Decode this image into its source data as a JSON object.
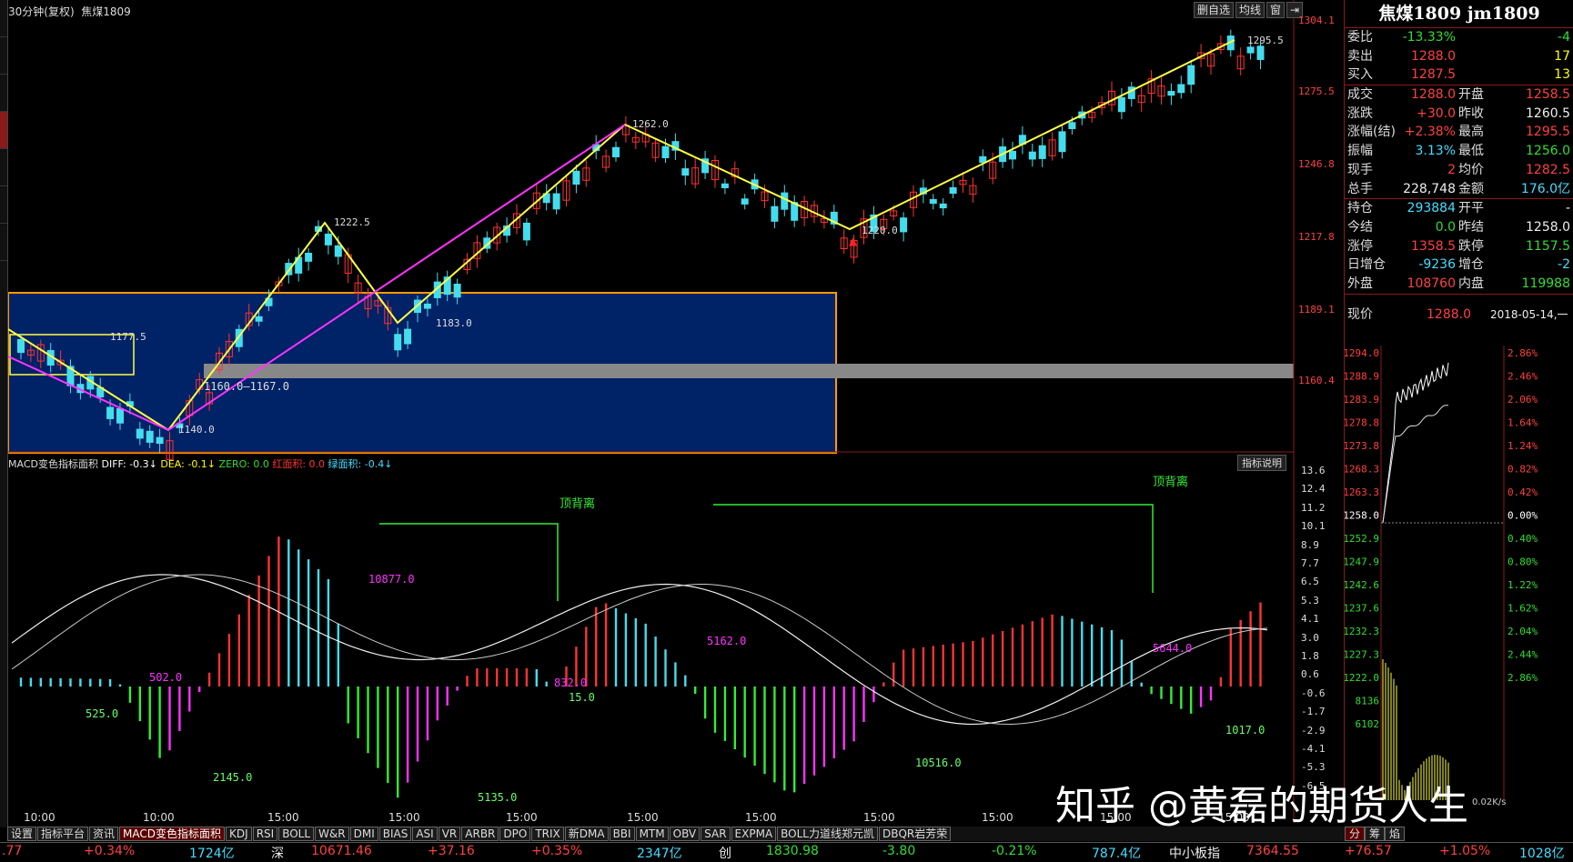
{
  "window": {
    "title_left": "30分钟(复权)",
    "title_symbol": "焦煤1809",
    "buttons": [
      "删自选",
      "均线",
      "窗",
      "⇥"
    ]
  },
  "price_axis": [
    "1304.1",
    "1275.5",
    "1246.8",
    "1217.8",
    "1189.1",
    "1160.4"
  ],
  "price_annotations": {
    "a": "1177.5",
    "b": "1140.0",
    "c": "1160.0—1167.0",
    "d": "1222.5",
    "e": "1183.0",
    "f": "1262.0",
    "g": "1220.0",
    "h": "1295.5"
  },
  "indicator": {
    "name": "MACD变色指标面积",
    "diff_label": "DIFF: -0.3↓",
    "dea_label": "DEA: -0.1↓",
    "zero_label": "ZERO: 0.0",
    "red_area_label": "红面积: 0.0",
    "green_area_label": "绿面积: -0.4↓",
    "button": "指标说明",
    "axis": [
      "13.6",
      "12.4",
      "11.2",
      "10.1",
      "8.9",
      "7.7",
      "6.5",
      "5.3",
      "4.1",
      "3.0",
      "1.8",
      "0.6",
      "-0.6",
      "-1.7",
      "-2.9",
      "-4.1",
      "-5.3",
      "-6.5"
    ],
    "divergence_label_1": "顶背离",
    "divergence_label_2": "顶背离",
    "areas": [
      "525.0",
      "502.0",
      "2145.0",
      "10877.0",
      "5135.0",
      "832.0",
      "15.0",
      "5162.0",
      "10516.0",
      "5644.0",
      "1017.0"
    ]
  },
  "x_axis": [
    "10:00",
    "10:00",
    "15:00",
    "15:00",
    "15:00",
    "15:00",
    "15:00",
    "15:00",
    "15:00",
    "15:00",
    "15:00"
  ],
  "quote": {
    "title": "焦煤1809 jm1809",
    "rows": [
      {
        "l1": "委比",
        "v1": "-13.33%",
        "c1": "grn",
        "l2": "",
        "v2": "-4",
        "c2": "grn"
      },
      {
        "l1": "卖出",
        "v1": "1288.0",
        "c1": "red",
        "l2": "",
        "v2": "17",
        "c2": "yel"
      },
      {
        "l1": "买入",
        "v1": "1287.5",
        "c1": "red",
        "l2": "",
        "v2": "13",
        "c2": "yel"
      },
      {
        "l1": "成交",
        "v1": "1288.0",
        "c1": "red",
        "l2": "开盘",
        "v2": "1258.5",
        "c2": "red"
      },
      {
        "l1": "涨跌",
        "v1": "+30.0",
        "c1": "red",
        "l2": "昨收",
        "v2": "1260.5",
        "c2": "wht"
      },
      {
        "l1": "涨幅(结)",
        "v1": "+2.38%",
        "c1": "red",
        "l2": "最高",
        "v2": "1295.5",
        "c2": "red"
      },
      {
        "l1": "振幅",
        "v1": "3.13%",
        "c1": "cyan",
        "l2": "最低",
        "v2": "1256.0",
        "c2": "grn"
      },
      {
        "l1": "现手",
        "v1": "2",
        "c1": "red",
        "l2": "均价",
        "v2": "1282.5",
        "c2": "red"
      },
      {
        "l1": "总手",
        "v1": "228,748",
        "c1": "wht",
        "l2": "金额",
        "v2": "176.0亿",
        "c2": "cyan"
      },
      {
        "l1": "持仓",
        "v1": "293884",
        "c1": "cyan",
        "l2": "开平",
        "v2": "-",
        "c2": "wht"
      },
      {
        "l1": "今结",
        "v1": "0.0",
        "c1": "grn",
        "l2": "昨结",
        "v2": "1258.0",
        "c2": "wht"
      },
      {
        "l1": "涨停",
        "v1": "1358.5",
        "c1": "red",
        "l2": "跌停",
        "v2": "1157.5",
        "c2": "grn"
      },
      {
        "l1": "日增仓",
        "v1": "-9236",
        "c1": "cyan",
        "l2": "增仓",
        "v2": "-2",
        "c2": "cyan"
      },
      {
        "l1": "外盘",
        "v1": "108760",
        "c1": "red",
        "l2": "内盘",
        "v2": "119988",
        "c2": "grn"
      }
    ],
    "now_label": "现价",
    "now_value": "1288.0",
    "now_date": "2018-05-14,一"
  },
  "mini_chart": {
    "left_axis": [
      "1294.0",
      "1288.9",
      "1283.9",
      "1278.8",
      "1273.8",
      "1268.3",
      "1263.3",
      "1258.0",
      "1252.9",
      "1247.9",
      "1242.6",
      "1237.6",
      "1232.3",
      "1227.3",
      "1222.0",
      "8136",
      "6102"
    ],
    "right_axis": [
      "2.86%",
      "2.46%",
      "2.06%",
      "1.64%",
      "1.24%",
      "0.82%",
      "0.42%",
      "0.00%",
      "0.40%",
      "0.80%",
      "1.22%",
      "1.62%",
      "2.04%",
      "2.44%",
      "2.86%"
    ],
    "speed": "0.02K/s"
  },
  "bottom_tabs": [
    "设置",
    "指标平台",
    "资讯",
    "MACD变色指标面积",
    "KDJ",
    "RSI",
    "BOLL",
    "W&R",
    "DMI",
    "BIAS",
    "ASI",
    "VR",
    "ARBR",
    "DPO",
    "TRIX",
    "新DMA",
    "BBI",
    "MTM",
    "OBV",
    "SAR",
    "EXPMA",
    "BOLL力道线郑元凯",
    "DBQR岩芳荣"
  ],
  "right_tabs": [
    "分",
    "筹",
    "焰"
  ],
  "status": {
    "s1": ".77",
    "s2": "+0.34%",
    "s3": "1724亿",
    "s4": "深",
    "s5": "10671.46",
    "s6": "+37.16",
    "s7": "+0.35%",
    "s8": "2347亿",
    "s9": "创",
    "s10": "1830.98",
    "s11": "-3.80",
    "s12": "-0.21%",
    "s13": "787.4亿",
    "s14": "中小板指",
    "s15": "7364.55",
    "s16": "+76.57",
    "s17": "+1.05%",
    "s18": "1028亿"
  },
  "watermark": "知乎 @黄磊的期货人生",
  "colors": {
    "up": "#ff3333",
    "down": "#44ddee",
    "trend": "#ffff44",
    "magenta": "#ff33ff",
    "box": "#002266"
  }
}
